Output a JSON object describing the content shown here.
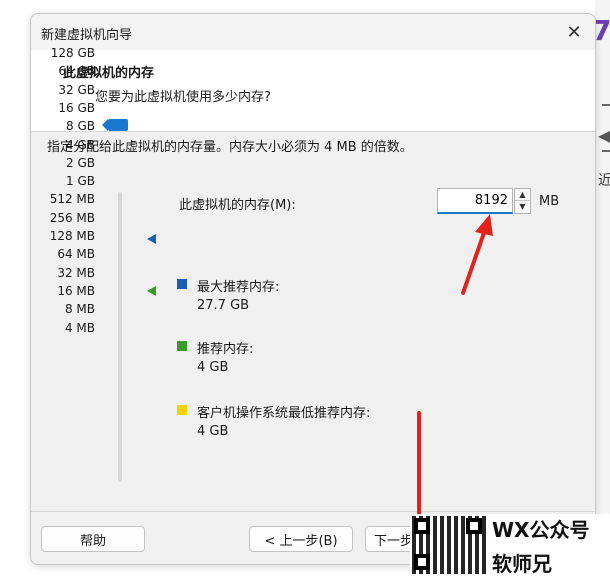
{
  "dialog": {
    "title": "新建虚拟机向导",
    "close_glyph": "✕",
    "header_title": "此虚拟机的内存",
    "header_subtitle": "您要为此虚拟机使用多少内存?",
    "description": "指定分配给此虚拟机的内存量。内存大小必须为 4 MB 的倍数。"
  },
  "memory": {
    "label": "此虚拟机的内存(M):",
    "value": "8192",
    "unit": "MB",
    "scale_labels": [
      "128 GB",
      "64 GB",
      "32 GB",
      "16 GB",
      "8 GB",
      "4 GB",
      "2 GB",
      "1 GB",
      "512 MB",
      "256 MB",
      "128 MB",
      "64 MB",
      "32 MB",
      "16 MB",
      "8 MB",
      "4 MB"
    ],
    "selected_index": 4
  },
  "legend": {
    "max": {
      "label": "最大推荐内存:",
      "value": "27.7 GB",
      "color": "#1b5fae"
    },
    "recommended": {
      "label": "推荐内存:",
      "value": "4 GB",
      "color": "#3a9a2a"
    },
    "min": {
      "label": "客户机操作系统最低推荐内存:",
      "value": "4 GB",
      "color": "#f2d200"
    }
  },
  "footer": {
    "help": "帮助",
    "back": "< 上一步(B)",
    "next": "下一步"
  },
  "overlay": {
    "watermark_line1": "WX公众号",
    "watermark_line2": "软师兄",
    "background_text": "近"
  },
  "colors": {
    "annotation_red": "#e0231d",
    "accent": "#1b78d0"
  }
}
